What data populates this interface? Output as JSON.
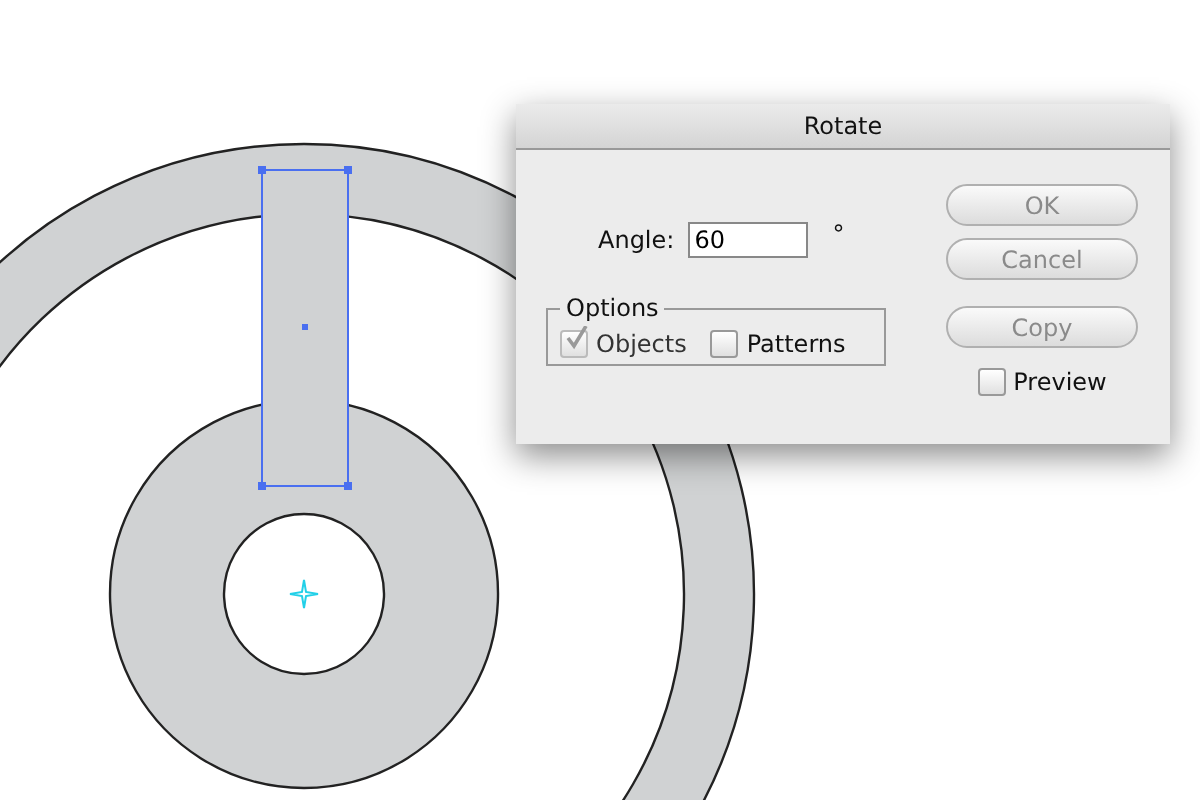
{
  "dialog": {
    "title": "Rotate",
    "angle": {
      "label": "Angle:",
      "value": "60",
      "unit": "°"
    },
    "options": {
      "legend": "Options",
      "checkboxes": [
        {
          "label": "Objects",
          "checked": true,
          "disabled": true
        },
        {
          "label": "Patterns",
          "checked": false,
          "disabled": false
        }
      ]
    },
    "buttons": [
      {
        "label": "OK",
        "disabled": true
      },
      {
        "label": "Cancel",
        "disabled": true
      },
      {
        "label": "Copy",
        "disabled": true
      }
    ],
    "preview": {
      "label": "Preview",
      "checked": false
    }
  }
}
